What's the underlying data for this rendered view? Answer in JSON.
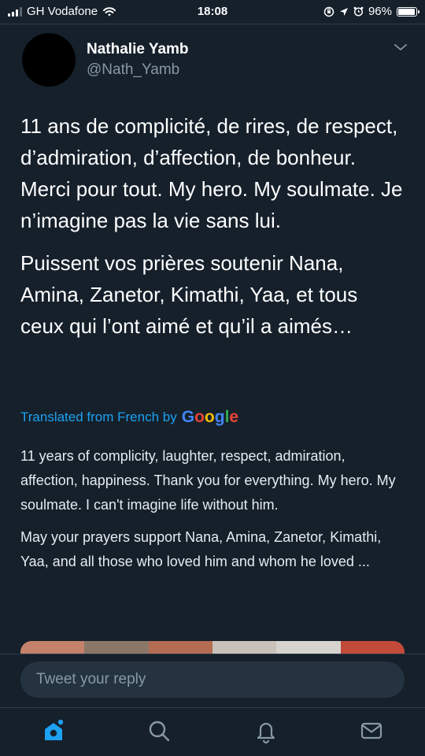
{
  "status_bar": {
    "carrier": "GH Vodafone",
    "time": "18:08",
    "battery": "96%"
  },
  "tweet": {
    "author_name": "Nathalie Yamb",
    "author_handle": "@Nath_Yamb",
    "paragraphs": [
      "11 ans de complicité, de rires, de respect, d’admiration, d’affection, de bonheur. Merci pour tout. My hero. My soulmate. Je n’imagine pas la vie sans lui.",
      "Puissent vos prières soutenir Nana, Amina, Zanetor, Kimathi, Yaa, et tous ceux qui l’ont aimé et qu’il a aimés…"
    ],
    "translated_label": "Translated from French by",
    "translator_logo": "Google",
    "translation": [
      "11 years of complicity, laughter, respect, admiration, affection, happiness. Thank you for everything. My hero. My soulmate. I can't imagine life without him.",
      "May your prayers support Nana, Amina, Zanetor, Kimathi, Yaa, and all those who loved him and whom he loved ..."
    ]
  },
  "reply": {
    "placeholder": "Tweet your reply"
  },
  "tab_bar": {
    "items": [
      "home-icon",
      "search-icon",
      "notifications-icon",
      "messages-icon"
    ]
  },
  "colors": {
    "background": "#15202b",
    "accent": "#1da1f2",
    "secondary_text": "#8899a6",
    "reply_field": "#253341"
  }
}
